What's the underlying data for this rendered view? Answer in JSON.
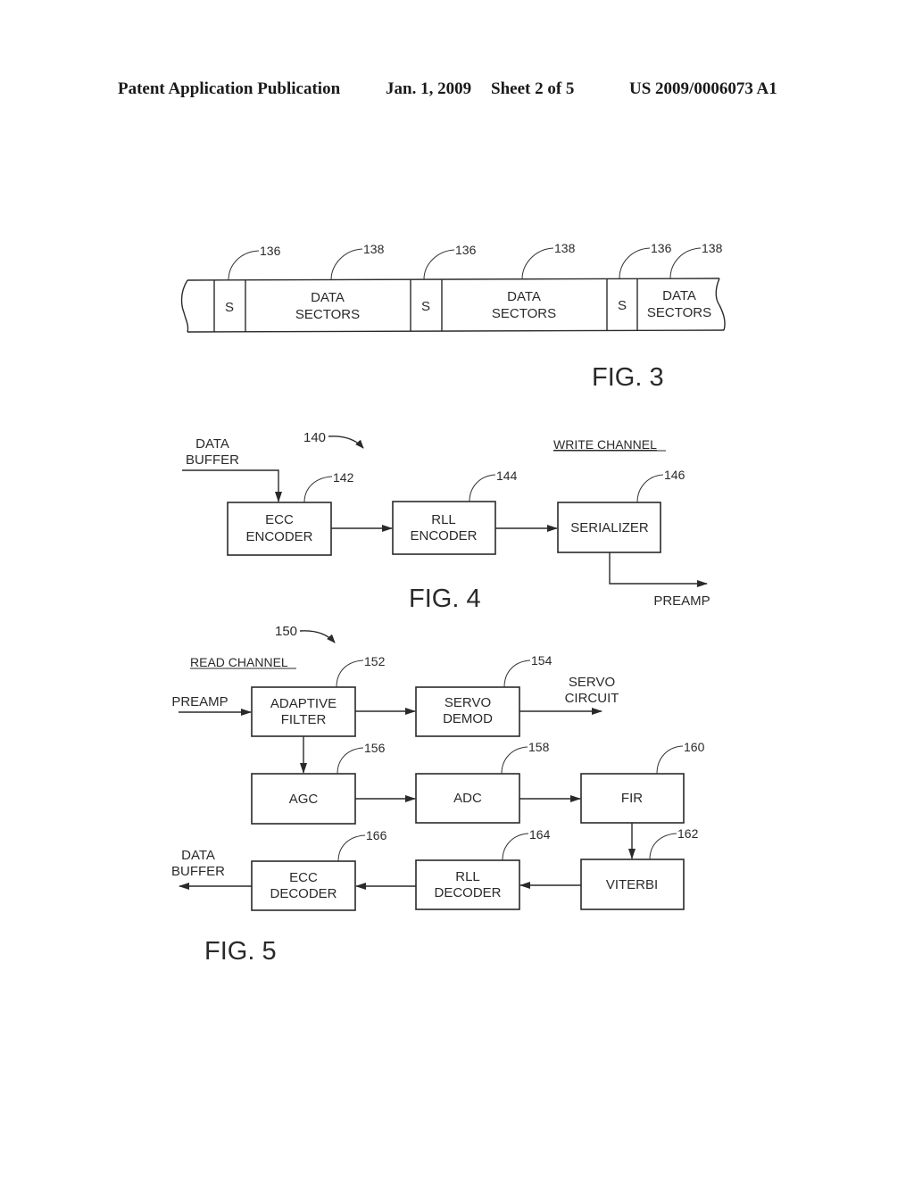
{
  "header": {
    "publication": "Patent Application Publication",
    "date": "Jan. 1, 2009",
    "sheet": "Sheet 2 of 5",
    "number": "US 2009/0006073 A1"
  },
  "fig3": {
    "caption": "FIG. 3",
    "segments": [
      {
        "label": "S",
        "ref": "136"
      },
      {
        "label_line1": "DATA",
        "label_line2": "SECTORS",
        "ref": "138"
      },
      {
        "label": "S",
        "ref": "136"
      },
      {
        "label_line1": "DATA",
        "label_line2": "SECTORS",
        "ref": "138"
      },
      {
        "label": "S",
        "ref": "136"
      },
      {
        "label_line1": "DATA",
        "label_line2": "SECTORS",
        "ref": "138"
      }
    ]
  },
  "fig4": {
    "caption": "FIG. 4",
    "ref": "140",
    "title": "WRITE CHANNEL",
    "input_line1": "DATA",
    "input_line2": "BUFFER",
    "output": "PREAMP",
    "blocks": [
      {
        "line1": "ECC",
        "line2": "ENCODER",
        "ref": "142"
      },
      {
        "line1": "RLL",
        "line2": "ENCODER",
        "ref": "144"
      },
      {
        "line1": "SERIALIZER",
        "ref": "146"
      }
    ]
  },
  "fig5": {
    "caption": "FIG. 5",
    "ref": "150",
    "title": "READ CHANNEL",
    "input": "PREAMP",
    "servo_out_line1": "SERVO",
    "servo_out_line2": "CIRCUIT",
    "output_line1": "DATA",
    "output_line2": "BUFFER",
    "blocks": {
      "adaptive_filter": {
        "line1": "ADAPTIVE",
        "line2": "FILTER",
        "ref": "152"
      },
      "servo_demod": {
        "line1": "SERVO",
        "line2": "DEMOD",
        "ref": "154"
      },
      "agc": {
        "line1": "AGC",
        "ref": "156"
      },
      "adc": {
        "line1": "ADC",
        "ref": "158"
      },
      "fir": {
        "line1": "FIR",
        "ref": "160"
      },
      "viterbi": {
        "line1": "VITERBI",
        "ref": "162"
      },
      "rll_decoder": {
        "line1": "RLL",
        "line2": "DECODER",
        "ref": "164"
      },
      "ecc_decoder": {
        "line1": "ECC",
        "line2": "DECODER",
        "ref": "166"
      }
    }
  }
}
